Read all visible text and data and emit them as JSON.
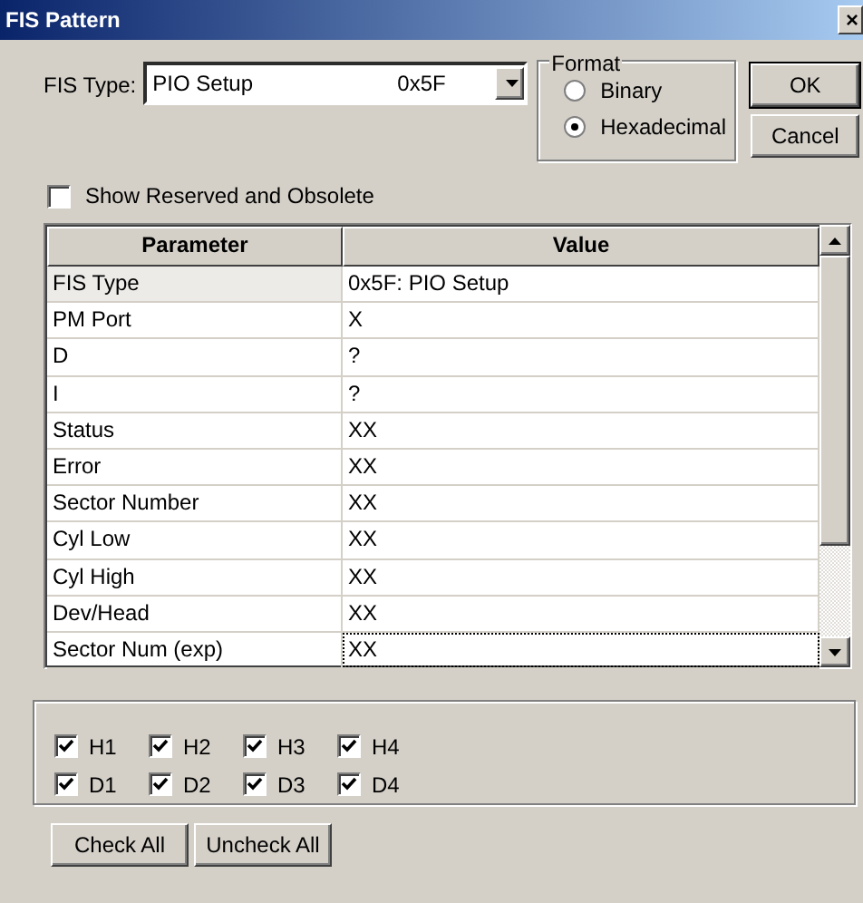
{
  "window": {
    "title": "FIS Pattern",
    "close": "×"
  },
  "fis_type": {
    "label": "FIS Type:",
    "name": "PIO Setup",
    "code": "0x5F"
  },
  "format": {
    "legend": "Format",
    "options": [
      {
        "label": "Binary",
        "selected": false
      },
      {
        "label": "Hexadecimal",
        "selected": true
      }
    ]
  },
  "buttons": [
    "OK",
    "Cancel"
  ],
  "show_reserved": {
    "label": "Show Reserved and Obsolete",
    "checked": false
  },
  "table": {
    "columns": [
      "Parameter",
      "Value"
    ],
    "rows": [
      {
        "parameter": "FIS Type",
        "value": "0x5F: PIO Setup",
        "focused": false
      },
      {
        "parameter": "PM Port",
        "value": "X",
        "focused": false
      },
      {
        "parameter": "D",
        "value": "?",
        "focused": false
      },
      {
        "parameter": "I",
        "value": "?",
        "focused": false
      },
      {
        "parameter": "Status",
        "value": "XX",
        "focused": false
      },
      {
        "parameter": "Error",
        "value": "XX",
        "focused": false
      },
      {
        "parameter": "Sector Number",
        "value": "XX",
        "focused": false
      },
      {
        "parameter": "Cyl Low",
        "value": "XX",
        "focused": false
      },
      {
        "parameter": "Cyl High",
        "value": "XX",
        "focused": false
      },
      {
        "parameter": "Dev/Head",
        "value": "XX",
        "focused": false
      },
      {
        "parameter": "Sector Num (exp)",
        "value": "XX",
        "focused": true
      }
    ]
  },
  "ports": [
    [
      {
        "label": "H1",
        "checked": true
      },
      {
        "label": "H2",
        "checked": true
      },
      {
        "label": "H3",
        "checked": true
      },
      {
        "label": "H4",
        "checked": true
      }
    ],
    [
      {
        "label": "D1",
        "checked": true
      },
      {
        "label": "D2",
        "checked": true
      },
      {
        "label": "D3",
        "checked": true
      },
      {
        "label": "D4",
        "checked": true
      }
    ]
  ],
  "bottom_buttons": [
    "Check All",
    "Uncheck All"
  ]
}
